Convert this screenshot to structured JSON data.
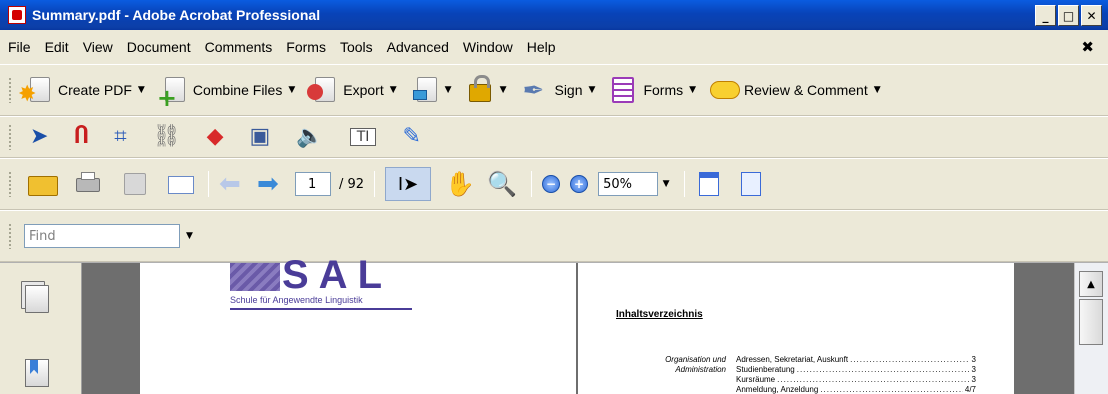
{
  "window": {
    "title": "Summary.pdf - Adobe Acrobat Professional",
    "minimize": "_",
    "maximize": "□",
    "close": "✕"
  },
  "menu": {
    "items": [
      "File",
      "Edit",
      "View",
      "Document",
      "Comments",
      "Forms",
      "Tools",
      "Advanced",
      "Window",
      "Help"
    ],
    "close_doc": "✖"
  },
  "task_toolbar": {
    "create_pdf": "Create PDF",
    "combine_files": "Combine Files",
    "export": "Export",
    "sign": "Sign",
    "forms": "Forms",
    "review_comment": "Review & Comment",
    "dropdown": "▼"
  },
  "navigation": {
    "current_page": "1",
    "total_pages": "/ 92",
    "zoom_level": "50%",
    "zoom_out": "−",
    "zoom_in": "+"
  },
  "find": {
    "placeholder": "Find"
  },
  "document": {
    "logo_letters": "SAL",
    "logo_subtitle": "Schule für Angewendte Linguistik",
    "toc_title": "Inhaltsverzeichnis",
    "toc_section": [
      "Organisation und",
      "Administration"
    ],
    "toc_entries": [
      {
        "label": "Adressen, Sekretariat, Auskunft",
        "page": "3"
      },
      {
        "label": "Studienberatung",
        "page": "3"
      },
      {
        "label": "Kursräume",
        "page": "3"
      },
      {
        "label": "Anmeldung, Anzeldung",
        "page": "4/7"
      }
    ]
  }
}
